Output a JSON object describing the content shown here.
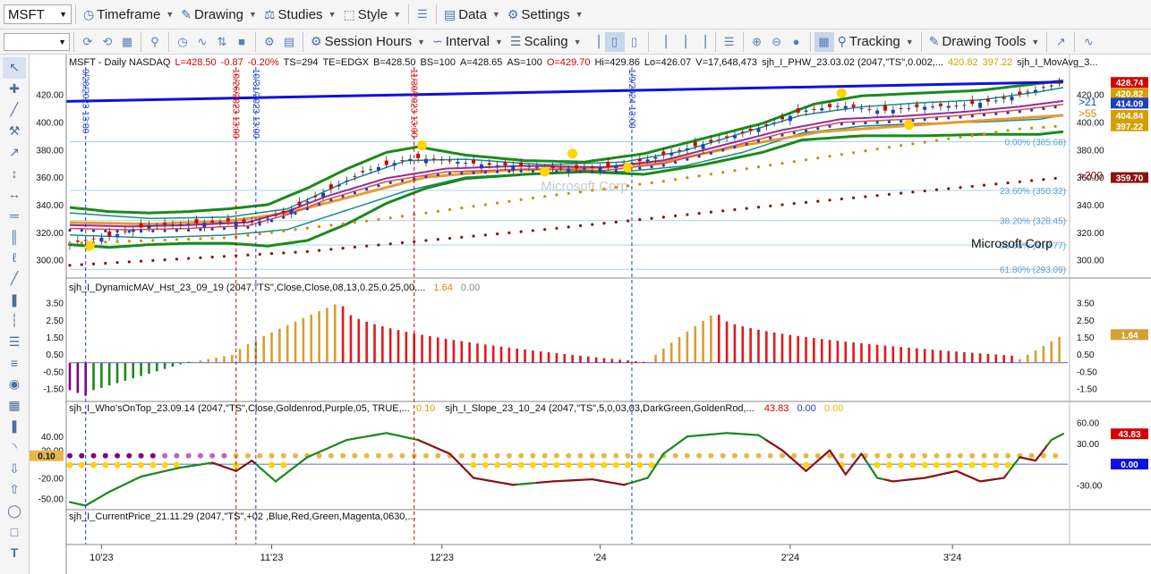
{
  "toolbar1": {
    "symbol": "MSFT",
    "items": [
      {
        "label": "Timeframe",
        "icon": "timeframe-icon"
      },
      {
        "label": "Drawing",
        "icon": "pencil-icon"
      },
      {
        "label": "Studies",
        "icon": "flask-icon"
      },
      {
        "label": "Style",
        "icon": "style-icon"
      },
      {
        "label": "Data",
        "icon": "data-icon"
      },
      {
        "label": "Settings",
        "icon": "gear-icon"
      }
    ]
  },
  "toolbar2": {
    "items": [
      {
        "label": "Session Hours",
        "icon": "gear-icon"
      },
      {
        "label": "Interval",
        "icon": "interval-icon"
      },
      {
        "label": "Scaling",
        "icon": "scaling-icon"
      },
      {
        "label": "Tracking",
        "icon": "tracking-icon"
      },
      {
        "label": "Drawing Tools",
        "icon": "pencil-icon"
      }
    ]
  },
  "legend": {
    "symbol": "MSFT - Daily  NASDAQ",
    "fields": [
      {
        "text": "L=428.50",
        "color": "#d40000"
      },
      {
        "text": "-0.87",
        "color": "#d40000"
      },
      {
        "text": "-0.20%",
        "color": "#d40000"
      },
      {
        "text": "TS=294",
        "color": "#111111"
      },
      {
        "text": "TE=EDGX",
        "color": "#111111"
      },
      {
        "text": "B=428.50",
        "color": "#111111"
      },
      {
        "text": "BS=100",
        "color": "#111111"
      },
      {
        "text": "A=428.65",
        "color": "#111111"
      },
      {
        "text": "AS=100",
        "color": "#111111"
      },
      {
        "text": "O=429.70",
        "color": "#d40000"
      },
      {
        "text": "Hi=429.86",
        "color": "#111111"
      },
      {
        "text": "Lo=426.07",
        "color": "#111111"
      },
      {
        "text": "V=17,648,473",
        "color": "#111111"
      },
      {
        "text": "sjh_I_PHW_23.03.02 (2047,\"TS\",0.002,...",
        "color": "#111111"
      },
      {
        "text": "420.82",
        "color": "#d4a000"
      },
      {
        "text": "397.22",
        "color": "#d4a000"
      },
      {
        "text": "sjh_I_MovAvg_3...",
        "color": "#111111"
      }
    ]
  },
  "chart_data": {
    "type": "line",
    "title": "MSFT - Daily  NASDAQ",
    "watermark": "Microsoft Corp",
    "company_label": "Microsoft Corp",
    "price_pane": {
      "y_ticks": [
        "420.00",
        "400.00",
        "380.00",
        "360.00",
        "340.00",
        "320.00",
        "300.00"
      ],
      "ylim": [
        290,
        436
      ],
      "fib_levels": [
        {
          "label": "0.00% (385.68)",
          "value": 385.68
        },
        {
          "label": "23.60% (350.32)",
          "value": 350.32
        },
        {
          "label": "38.20% (328.45)",
          "value": 328.45
        },
        {
          "label": "50.00% (310.77)",
          "value": 310.77
        },
        {
          "label": "61.80% (293.09)",
          "value": 293.09
        }
      ],
      "right_badges": [
        {
          "text": "428.74",
          "bg": "#d40000",
          "value": 428.74
        },
        {
          "text": "420.82",
          "bg": "#d4a000",
          "value": 420.82
        },
        {
          "text": "414.09",
          "bg": "#1c3fbf",
          "value": 414.09
        },
        {
          "text": "404.84",
          "bg": "#d4a000",
          "value": 404.84
        },
        {
          "text": "397.22",
          "bg": "#d4a000",
          "value": 397.22
        },
        {
          "text": "359.70",
          "bg": "#8b1010",
          "value": 359.7
        }
      ],
      "inline_labels": [
        {
          "text": ">21",
          "color": "#1c3fbf",
          "value": 414.5
        },
        {
          "text": ">55",
          "color": "#d48a00",
          "value": 406
        },
        {
          "text": ">200",
          "color": "#8b1010",
          "value": 361
        }
      ],
      "vertical_markers": [
        {
          "text": "9/28/2023 13:00",
          "color": "#1c3fbf",
          "x_index": 4
        },
        {
          "text": "10/26/2023 13:00",
          "color": "#d40000",
          "x_index": 42
        },
        {
          "text": "10/31/2023 13:00",
          "color": "#1c3fbf",
          "x_index": 47
        },
        {
          "text": "11/30/2023 13:00",
          "color": "#d40000",
          "x_index": 87
        },
        {
          "text": "1/9/2024 13:00",
          "color": "#1c3fbf",
          "x_index": 142
        }
      ]
    },
    "hist_pane": {
      "label": "sjh_I_DynamicMAV_Hst_23_09_19 (2047,\"TS\",Close,Close,08,13,0.25,0.25,00,...",
      "value_a": "1.64",
      "value_b": "0.00",
      "y_ticks": [
        "3.50",
        "2.50",
        "1.50",
        "0.50",
        "-0.50",
        "-1.50"
      ],
      "ylim": [
        -2.1,
        4.0
      ],
      "badge": "1.64"
    },
    "osc_pane": {
      "label_a": "sjh_I_Who'sOnTop_23.09.14 (2047,\"TS\",Close,Goldenrod,Purple,05,  TRUE,...",
      "value_a": "0.10",
      "label_b": "sjh_I_Slope_23_10_24 (2047,\"TS\",5,0,03,03,DarkGreen,GoldenRod,...",
      "value_b1": "43.83",
      "value_b2": "0.00",
      "value_b3": "0.00",
      "left_ticks": [
        "40.00",
        "20.00",
        "10.00",
        "-20.00",
        "-50.00"
      ],
      "right_ticks": [
        "60.00",
        "30.00",
        "-30.00"
      ],
      "ylim": [
        -62,
        70
      ],
      "badges": [
        "43.83",
        "0.00"
      ],
      "left_badge": "0.10"
    },
    "current_pane": {
      "label": "sjh_I_CurrentPrice_21.11.29 (2047,\"TS\",+02 ,Blue,Red,Green,Magenta,0630,..."
    },
    "x_ticks": [
      {
        "label": "10'23",
        "x_index": 8
      },
      {
        "label": "11'23",
        "x_index": 51
      },
      {
        "label": "12'23",
        "x_index": 94
      },
      {
        "label": "'24",
        "x_index": 134
      },
      {
        "label": "2'24",
        "x_index": 182
      },
      {
        "label": "3'24",
        "x_index": 223
      }
    ],
    "n_bars": 252,
    "price": {
      "close": [
        [
          0,
          312
        ],
        [
          10,
          317
        ],
        [
          20,
          325
        ],
        [
          30,
          326
        ],
        [
          40,
          328
        ],
        [
          47,
          327
        ],
        [
          55,
          335
        ],
        [
          65,
          350
        ],
        [
          75,
          365
        ],
        [
          87,
          374
        ],
        [
          95,
          372
        ],
        [
          105,
          369
        ],
        [
          115,
          368
        ],
        [
          125,
          366
        ],
        [
          135,
          367
        ],
        [
          145,
          372
        ],
        [
          155,
          380
        ],
        [
          165,
          388
        ],
        [
          175,
          396
        ],
        [
          185,
          408
        ],
        [
          195,
          412
        ],
        [
          205,
          408
        ],
        [
          215,
          411
        ],
        [
          225,
          412
        ],
        [
          235,
          416
        ],
        [
          245,
          424
        ],
        [
          251,
          428.5
        ]
      ],
      "ema21": [
        [
          0,
          324
        ],
        [
          15,
          323
        ],
        [
          30,
          324
        ],
        [
          45,
          326
        ],
        [
          55,
          334
        ],
        [
          65,
          345
        ],
        [
          80,
          358
        ],
        [
          95,
          365
        ],
        [
          115,
          367
        ],
        [
          135,
          366
        ],
        [
          150,
          371
        ],
        [
          165,
          382
        ],
        [
          180,
          393
        ],
        [
          195,
          401
        ],
        [
          210,
          403
        ],
        [
          225,
          406
        ],
        [
          240,
          410
        ],
        [
          251,
          414.09
        ]
      ],
      "ema55": [
        [
          0,
          327
        ],
        [
          20,
          326
        ],
        [
          40,
          328
        ],
        [
          55,
          334
        ],
        [
          70,
          345
        ],
        [
          90,
          360
        ],
        [
          110,
          365
        ],
        [
          135,
          367
        ],
        [
          150,
          371
        ],
        [
          170,
          383
        ],
        [
          190,
          393
        ],
        [
          210,
          397
        ],
        [
          230,
          401
        ],
        [
          251,
          404.84
        ]
      ],
      "sma200": [
        [
          0,
          296
        ],
        [
          60,
          306
        ],
        [
          120,
          322
        ],
        [
          180,
          340
        ],
        [
          251,
          359.7
        ]
      ],
      "dots55": [
        [
          0,
          312
        ],
        [
          40,
          316
        ],
        [
          80,
          330
        ],
        [
          120,
          346
        ],
        [
          150,
          357
        ],
        [
          180,
          370
        ],
        [
          210,
          383
        ],
        [
          240,
          395
        ],
        [
          251,
          397.22
        ]
      ],
      "band_outer_upper": [
        [
          0,
          338
        ],
        [
          10,
          335
        ],
        [
          20,
          334
        ],
        [
          30,
          335
        ],
        [
          40,
          337
        ],
        [
          50,
          340
        ],
        [
          60,
          352
        ],
        [
          70,
          366
        ],
        [
          80,
          378
        ],
        [
          88,
          382
        ],
        [
          100,
          376
        ],
        [
          115,
          372
        ],
        [
          130,
          371
        ],
        [
          145,
          377
        ],
        [
          160,
          388
        ],
        [
          175,
          399
        ],
        [
          188,
          413
        ],
        [
          200,
          419
        ],
        [
          215,
          421
        ],
        [
          230,
          423
        ],
        [
          245,
          428
        ],
        [
          251,
          430
        ]
      ],
      "band_outer_lower": [
        [
          0,
          311
        ],
        [
          10,
          309
        ],
        [
          20,
          311
        ],
        [
          30,
          312
        ],
        [
          40,
          312
        ],
        [
          50,
          310
        ],
        [
          60,
          314
        ],
        [
          70,
          326
        ],
        [
          80,
          341
        ],
        [
          90,
          352
        ],
        [
          100,
          359
        ],
        [
          115,
          362
        ],
        [
          130,
          364
        ],
        [
          145,
          362
        ],
        [
          160,
          369
        ],
        [
          175,
          378
        ],
        [
          185,
          387
        ],
        [
          200,
          390
        ],
        [
          215,
          390
        ],
        [
          230,
          391
        ],
        [
          245,
          391
        ],
        [
          251,
          393
        ]
      ],
      "band_inner_upper": [
        [
          0,
          334
        ],
        [
          20,
          330
        ],
        [
          40,
          331
        ],
        [
          55,
          337
        ],
        [
          70,
          357
        ],
        [
          85,
          372
        ],
        [
          100,
          373
        ],
        [
          120,
          369
        ],
        [
          140,
          371
        ],
        [
          155,
          379
        ],
        [
          170,
          392
        ],
        [
          185,
          405
        ],
        [
          200,
          411
        ],
        [
          215,
          414
        ],
        [
          230,
          416
        ],
        [
          245,
          422
        ],
        [
          251,
          425
        ]
      ],
      "band_inner_lower": [
        [
          0,
          318
        ],
        [
          20,
          316
        ],
        [
          40,
          318
        ],
        [
          55,
          322
        ],
        [
          70,
          336
        ],
        [
          85,
          350
        ],
        [
          100,
          360
        ],
        [
          120,
          363
        ],
        [
          140,
          364
        ],
        [
          155,
          368
        ],
        [
          170,
          378
        ],
        [
          185,
          392
        ],
        [
          200,
          397
        ],
        [
          215,
          399
        ],
        [
          230,
          400
        ],
        [
          245,
          402
        ],
        [
          251,
          405
        ]
      ],
      "resistance": [
        [
          0,
          415
        ],
        [
          251,
          429
        ]
      ],
      "pivots": [
        [
          5,
          310
        ],
        [
          89,
          383
        ],
        [
          120,
          364
        ],
        [
          127,
          377
        ],
        [
          141,
          367
        ],
        [
          195,
          421
        ],
        [
          212,
          398
        ]
      ]
    },
    "hist": {
      "segments": [
        {
          "from": 0,
          "to": 5,
          "start": -1.6,
          "end": -2.0,
          "color": "#800080"
        },
        {
          "from": 6,
          "to": 30,
          "start": -1.6,
          "end": 0.05,
          "color": "#1a8a1a"
        },
        {
          "from": 31,
          "to": 42,
          "start": 0.05,
          "end": 0.5,
          "color": "#d4a030"
        },
        {
          "from": 43,
          "to": 68,
          "start": 0.8,
          "end": 3.5,
          "color": "#d4a030"
        },
        {
          "from": 69,
          "to": 145,
          "start": 3.3,
          "end": 0.05,
          "color": "#e01a1a"
        },
        {
          "from": 146,
          "to": 163,
          "start": 0.05,
          "end": 2.9,
          "color": "#d4a030"
        },
        {
          "from": 164,
          "to": 239,
          "start": 2.8,
          "end": 0.4,
          "color": "#e01a1a"
        },
        {
          "from": 240,
          "to": 251,
          "start": 0.2,
          "end": 1.64,
          "color": "#d4a030"
        }
      ]
    },
    "osc": {
      "slope": [
        [
          0,
          -55
        ],
        [
          4,
          -60
        ],
        [
          10,
          -40
        ],
        [
          18,
          -18
        ],
        [
          28,
          -5
        ],
        [
          36,
          2
        ],
        [
          42,
          -10
        ],
        [
          46,
          5
        ],
        [
          52,
          -25
        ],
        [
          60,
          10
        ],
        [
          70,
          35
        ],
        [
          80,
          45
        ],
        [
          88,
          35
        ],
        [
          96,
          15
        ],
        [
          102,
          -20
        ],
        [
          112,
          -30
        ],
        [
          122,
          -25
        ],
        [
          132,
          -22
        ],
        [
          140,
          -30
        ],
        [
          146,
          -20
        ],
        [
          150,
          15
        ],
        [
          156,
          40
        ],
        [
          166,
          45
        ],
        [
          174,
          42
        ],
        [
          180,
          20
        ],
        [
          186,
          -10
        ],
        [
          192,
          20
        ],
        [
          196,
          -15
        ],
        [
          200,
          15
        ],
        [
          204,
          -20
        ],
        [
          208,
          -25
        ],
        [
          216,
          -20
        ],
        [
          224,
          -10
        ],
        [
          230,
          -25
        ],
        [
          236,
          -20
        ],
        [
          240,
          10
        ],
        [
          244,
          5
        ],
        [
          248,
          35
        ],
        [
          251,
          43.83
        ]
      ],
      "slope_red_ranges": [
        [
          36,
          46
        ],
        [
          88,
          112
        ],
        [
          118,
          140
        ],
        [
          176,
          200
        ],
        [
          206,
          236
        ],
        [
          240,
          246
        ]
      ],
      "whos_on_top_level": 0.1,
      "purple_range": [
        0,
        24
      ],
      "violet_range": [
        24,
        40
      ],
      "midline": 0
    }
  }
}
